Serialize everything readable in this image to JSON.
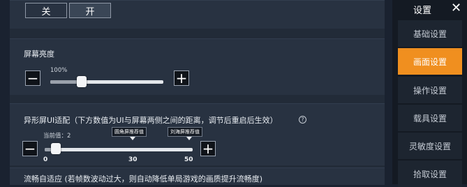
{
  "toggle": {
    "off": "关",
    "on": "开"
  },
  "brightness": {
    "title": "屏幕亮度",
    "value_text": "100%",
    "value": 100
  },
  "notch": {
    "title": "异形屏UI适配（下方数值为UI与屏幕两侧之间的距离，调节后重启后生效）",
    "current": "当前值：2",
    "value": 2,
    "tag_round": "圆角屏推荐值",
    "tag_notch": "刘海屏推荐值",
    "ticks": [
      "0",
      "30",
      "50"
    ],
    "help": "?"
  },
  "adaptive": {
    "title": "流畅自适应 (若帧数波动过大，则自动降低单局游戏的画质提升流畅度)"
  },
  "sidebar": {
    "title": "设置",
    "items": [
      {
        "label": "基础设置"
      },
      {
        "label": "画面设置"
      },
      {
        "label": "操作设置"
      },
      {
        "label": "载具设置"
      },
      {
        "label": "灵敏度设置"
      },
      {
        "label": "拾取设置"
      }
    ]
  },
  "colors": {
    "accent": "#f08f1f",
    "panel": "#283241",
    "sidebar": "#141a23"
  }
}
